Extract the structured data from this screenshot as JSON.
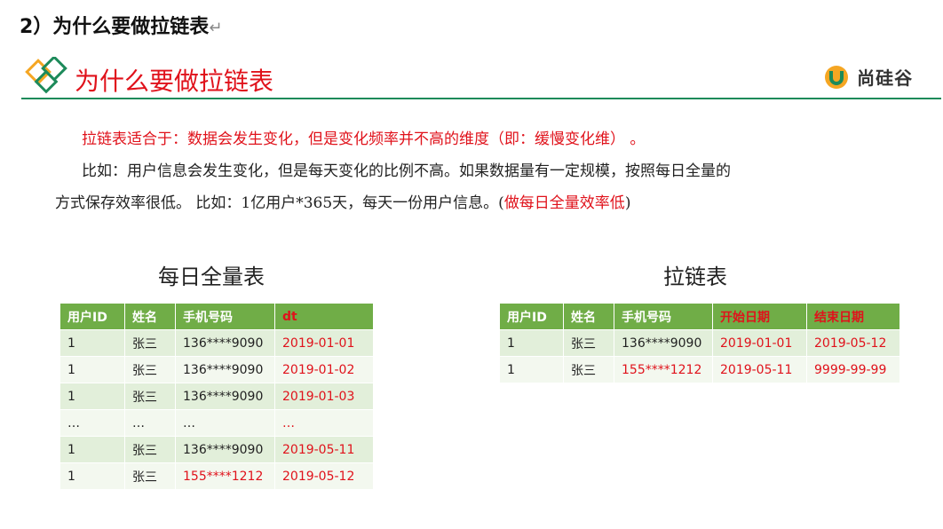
{
  "heading": {
    "text": "2）为什么要做拉链表",
    "return_mark": "↵"
  },
  "slide_title": "为什么要做拉链表",
  "brand": {
    "text": "尚硅谷"
  },
  "paragraphs": {
    "p1": "拉链表适合于：数据会发生变化，但是变化频率并不高的维度（即：缓慢变化维） 。",
    "p2": "比如：用户信息会发生变化，但是每天变化的比例不高。如果数据量有一定规模，按照每日全量的",
    "p3_main": "方式保存效率很低。 比如：1亿用户*365天，每天一份用户信息。(",
    "p3_red": "做每日全量效率低",
    "p3_end": ")"
  },
  "full_table": {
    "title": "每日全量表",
    "headers": [
      "用户ID",
      "姓名",
      "手机号码",
      "dt"
    ],
    "rows": [
      [
        "1",
        "张三",
        "136****9090",
        "2019-01-01"
      ],
      [
        "1",
        "张三",
        "136****9090",
        "2019-01-02"
      ],
      [
        "1",
        "张三",
        "136****9090",
        "2019-01-03"
      ],
      [
        "…",
        "…",
        "…",
        "…"
      ],
      [
        "1",
        "张三",
        "136****9090",
        "2019-05-11"
      ],
      [
        "1",
        "张三",
        "155****1212",
        "2019-05-12"
      ]
    ]
  },
  "zip_table": {
    "title": "拉链表",
    "headers": [
      "用户ID",
      "姓名",
      "手机号码",
      "开始日期",
      "结束日期"
    ],
    "rows": [
      [
        "1",
        "张三",
        "136****9090",
        "2019-01-01",
        "2019-05-12"
      ],
      [
        "1",
        "张三",
        "155****1212",
        "2019-05-11",
        "9999-99-99"
      ]
    ]
  },
  "colors": {
    "accent_red": "#e0121b",
    "header_green": "#70ad47",
    "rule_green": "#1d8a5a",
    "logo_orange": "#f5a623"
  }
}
